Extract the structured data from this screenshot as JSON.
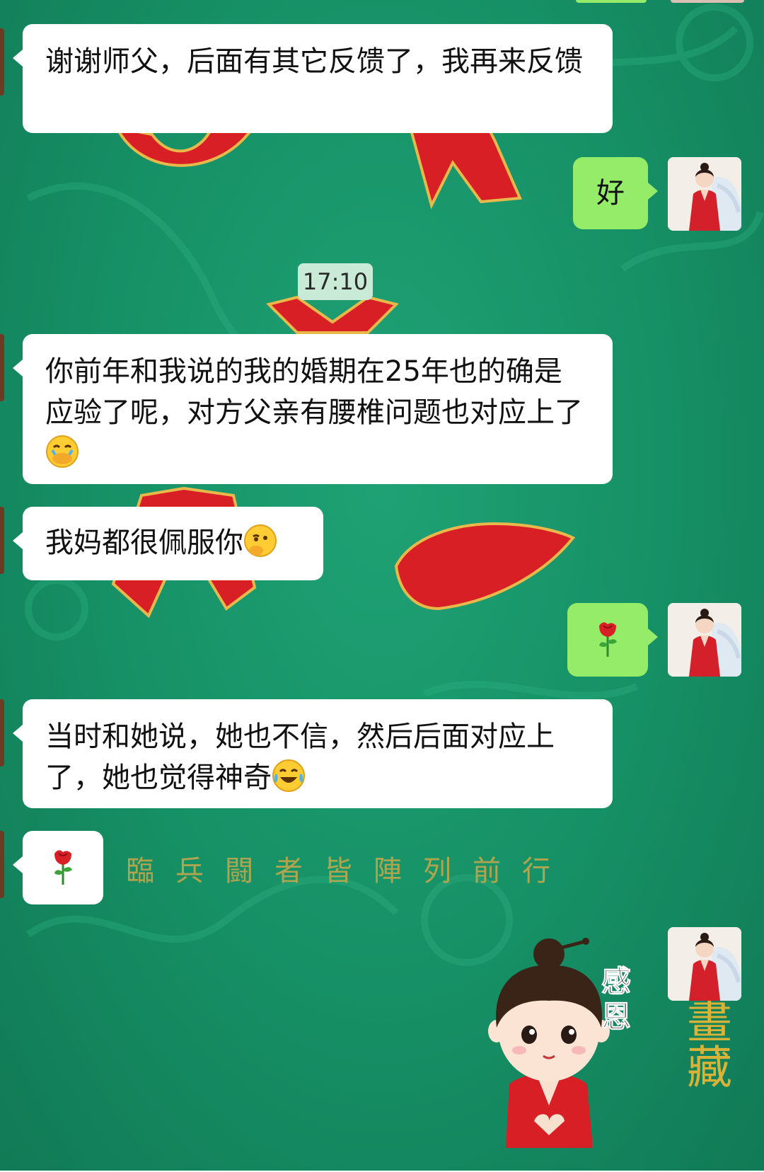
{
  "colors": {
    "background": "#168f65",
    "bubble_in": "#ffffff",
    "bubble_out": "#95ec69",
    "timestamp_bg": "#c8ead6",
    "watermark_gold": "#c9a94a"
  },
  "messages": [
    {
      "side": "in",
      "text": "谢谢师父，后面有其它反馈了，我再来反馈"
    },
    {
      "side": "out",
      "text": "好"
    },
    {
      "type": "timestamp",
      "text": "17:10"
    },
    {
      "side": "in",
      "text": " 你前年和我说的我的婚期在25年也的确是应验了呢，对方父亲有腰椎问题也对应上了",
      "emoji": "face-with-hand-over-mouth-icon"
    },
    {
      "side": "in",
      "text": "我妈都很佩服你",
      "emoji": "thinking-face-icon"
    },
    {
      "side": "out",
      "emoji": "rose-icon"
    },
    {
      "side": "in",
      "text": "当时和她说，她也不信，然后后面对应上了，她也觉得神奇",
      "emoji": "tears-of-joy-icon"
    },
    {
      "side": "in",
      "emoji": "rose-icon"
    },
    {
      "side": "out",
      "type": "sticker",
      "sticker_text": "感恩"
    }
  ],
  "background_text": {
    "watermark": "臨兵闘者皆陣列前行",
    "seal": "畫藏"
  }
}
